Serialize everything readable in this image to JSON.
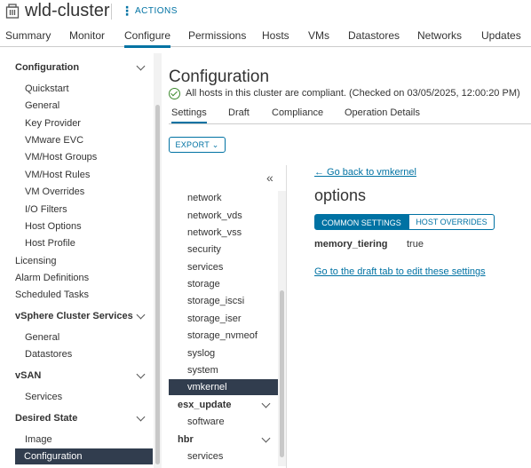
{
  "header": {
    "title": "wld-cluster",
    "actions_label": "ACTIONS"
  },
  "main_tabs": [
    {
      "label": "Summary"
    },
    {
      "label": "Monitor"
    },
    {
      "label": "Configure"
    },
    {
      "label": "Permissions"
    },
    {
      "label": "Hosts"
    },
    {
      "label": "VMs"
    },
    {
      "label": "Datastores"
    },
    {
      "label": "Networks"
    },
    {
      "label": "Updates"
    }
  ],
  "active_main_tab": "Configure",
  "sidebar": {
    "configuration": "Configuration",
    "config_items": [
      "Quickstart",
      "General",
      "Key Provider",
      "VMware EVC",
      "VM/Host Groups",
      "VM/Host Rules",
      "VM Overrides",
      "I/O Filters",
      "Host Options",
      "Host Profile"
    ],
    "licensing": "Licensing",
    "alarm_definitions": "Alarm Definitions",
    "scheduled_tasks": "Scheduled Tasks",
    "cluster_services": "vSphere Cluster Services",
    "cluster_services_items": [
      "General",
      "Datastores"
    ],
    "vsan": "vSAN",
    "vsan_items": [
      "Services"
    ],
    "desired_state": "Desired State",
    "desired_state_items": [
      "Image",
      "Configuration"
    ]
  },
  "page": {
    "title": "Configuration",
    "compliance_text": "All hosts in this cluster are compliant. (Checked on 03/05/2025, 12:00:20 PM)",
    "sub_tabs": [
      "Settings",
      "Draft",
      "Compliance",
      "Operation Details"
    ],
    "active_sub_tab": "Settings",
    "export_label": "EXPORT ⌄"
  },
  "tree": {
    "collapse_glyph": "«",
    "items": [
      "network",
      "network_vds",
      "network_vss",
      "security",
      "services",
      "storage",
      "storage_iscsi",
      "storage_iser",
      "storage_nvmeof",
      "syslog",
      "system",
      "vmkernel"
    ],
    "selected": "vmkernel",
    "esx_update": "esx_update",
    "esx_update_items": [
      "software"
    ],
    "hbr": "hbr",
    "hbr_items": [
      "services"
    ]
  },
  "detail": {
    "back_link": "← Go back to vmkernel",
    "title": "options",
    "toggle_common": "COMMON SETTINGS",
    "toggle_host": "HOST OVERRIDES",
    "setting_key": "memory_tiering",
    "setting_value": "true",
    "draft_link": "Go to the draft tab to edit these settings"
  },
  "colors": {
    "accent": "#0072a3",
    "selected_bg": "#313d4e",
    "success": "#3c8a2e"
  }
}
